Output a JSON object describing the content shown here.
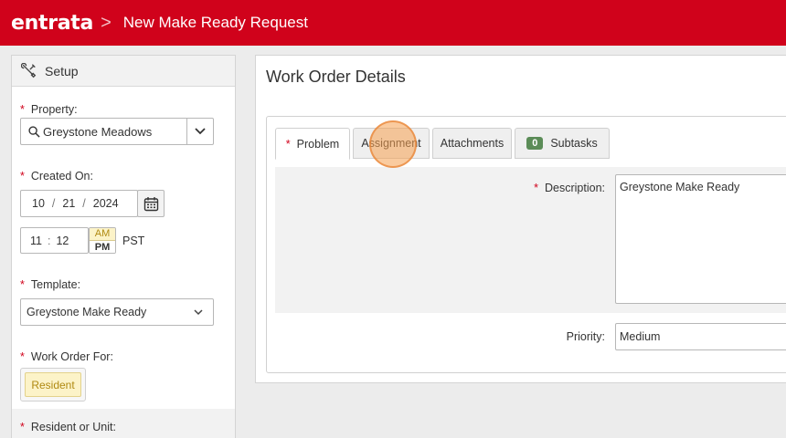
{
  "header": {
    "logo": "entrata",
    "breadcrumb_separator": ">",
    "title": "New Make Ready Request",
    "brand_color": "#d0021b"
  },
  "sidebar": {
    "heading": "Setup",
    "heading_icon": "tools-icon",
    "property": {
      "label": "Property:",
      "value": "Greystone Meadows"
    },
    "created_on": {
      "label": "Created On:",
      "month": "10",
      "day": "21",
      "year": "2024",
      "hour": "11",
      "minute": "12",
      "am_label": "AM",
      "pm_label": "PM",
      "timezone": "PST"
    },
    "template": {
      "label": "Template:",
      "value": "Greystone Make Ready"
    },
    "work_order_for": {
      "label": "Work Order For:",
      "option": "Resident"
    },
    "resident_or_unit": {
      "label": "Resident or Unit:"
    }
  },
  "main": {
    "title": "Work Order Details",
    "tabs": [
      {
        "label": "Problem",
        "required": true,
        "active": true
      },
      {
        "label": "Assignment"
      },
      {
        "label": "Attachments"
      },
      {
        "label": "Subtasks",
        "badge": "0"
      }
    ],
    "description": {
      "label": "Description:",
      "value": "Greystone Make Ready"
    },
    "priority": {
      "label": "Priority:",
      "value": "Medium"
    }
  }
}
